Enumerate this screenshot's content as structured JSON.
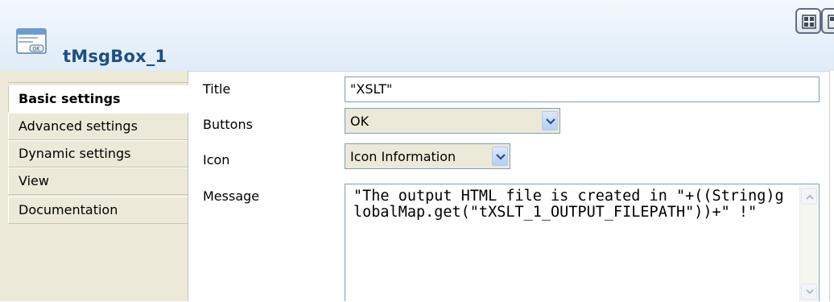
{
  "header": {
    "title": "tMsgBox_1",
    "icon": "msgbox-component-icon"
  },
  "toolbar": {
    "view_buttons": [
      "layout-grid-icon",
      "layout-columns-icon"
    ]
  },
  "tabs": [
    {
      "label": "Basic settings",
      "active": true
    },
    {
      "label": "Advanced settings",
      "active": false
    },
    {
      "label": "Dynamic settings",
      "active": false
    },
    {
      "label": "View",
      "active": false
    },
    {
      "label": "Documentation",
      "active": false
    }
  ],
  "form": {
    "title": {
      "label": "Title",
      "value": "\"XSLT\""
    },
    "buttons": {
      "label": "Buttons",
      "value": "OK"
    },
    "icon": {
      "label": "Icon",
      "value": "Icon Information"
    },
    "message": {
      "label": "Message",
      "value": "\"The output HTML file is created in \"+((String)globalMap.get(\"tXSLT_1_OUTPUT_FILEPATH\"))+\" !\""
    }
  },
  "colors": {
    "title_text": "#1d4f84",
    "panel_bg": "#ece9d8",
    "input_border": "#7f9db9"
  }
}
